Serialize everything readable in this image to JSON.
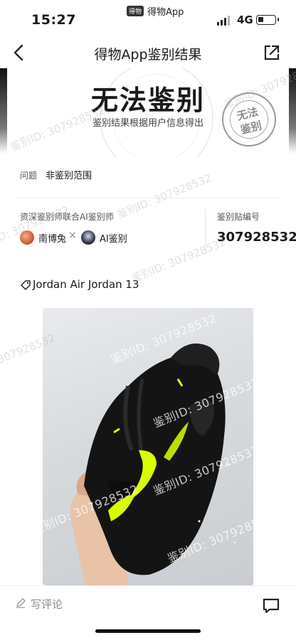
{
  "status": {
    "time": "15:27",
    "app_pill": "得物App",
    "app_pill_logo": "得物",
    "network": "4G"
  },
  "nav": {
    "title": "得物App鉴别结果"
  },
  "hero": {
    "result": "无法鉴别",
    "subtitle": "鉴别结果根据用户信息得出",
    "stamp_text": "无法\n鉴别"
  },
  "question": {
    "label": "问题",
    "value": "非鉴别范围"
  },
  "appraisers": {
    "label": "资深鉴别师联合AI鉴别师",
    "expert": "南博兔",
    "separator": "×",
    "ai": "AI鉴别"
  },
  "serial": {
    "label": "鉴别贴编号",
    "value": "307928532"
  },
  "product": {
    "name": "Jordan Air Jordan 13"
  },
  "watermark": {
    "text": "鉴别ID: 307928532"
  },
  "bottom": {
    "comment_placeholder": "写评论"
  },
  "colors": {
    "accent_yellow": "#d9ff00",
    "shoe_black": "#151515"
  }
}
